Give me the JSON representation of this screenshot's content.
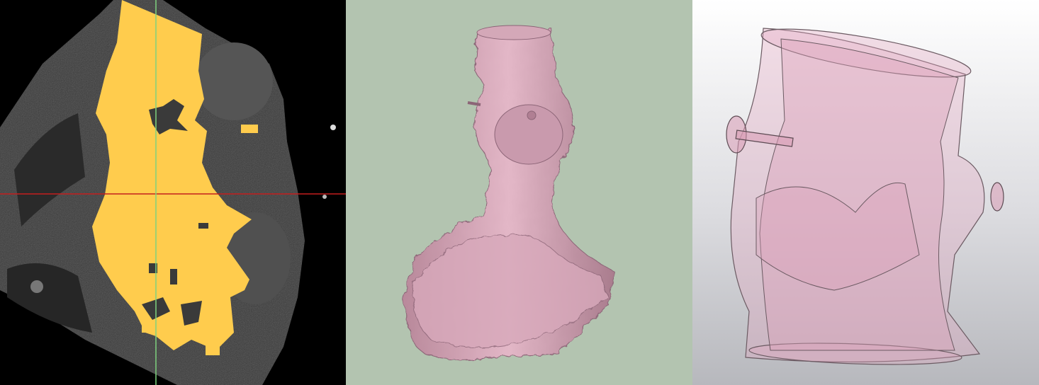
{
  "figure": {
    "panels": [
      {
        "view": "ct-slice-segmentation",
        "background": "#000000",
        "segmentation_color": "#ffcc4d",
        "crosshair_colors": [
          "#c41e1e",
          "#7ed27e"
        ]
      },
      {
        "view": "3d-surface-render",
        "background": "#b3c4b0",
        "surface_color": "#d9a5b8"
      },
      {
        "view": "3d-translucent-model",
        "background": "#e6e6ea",
        "surface_color": "#e2a6c0"
      }
    ]
  }
}
